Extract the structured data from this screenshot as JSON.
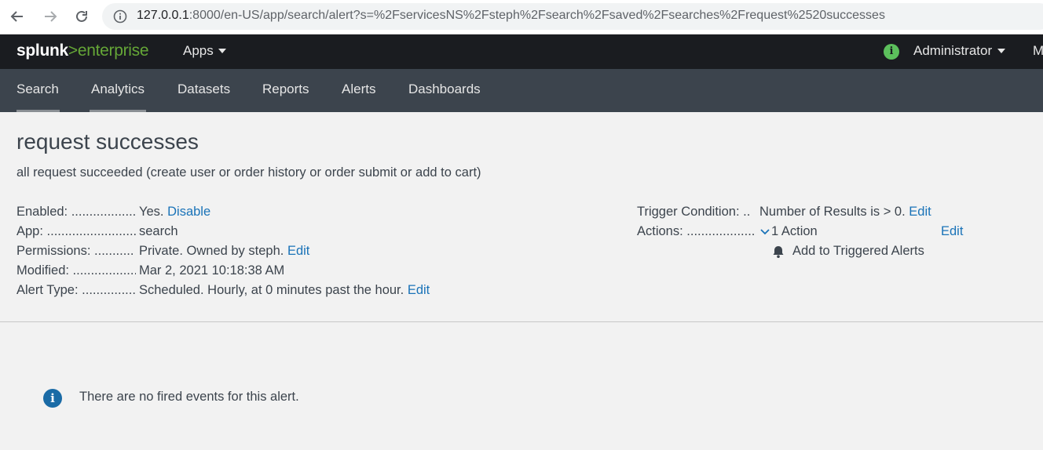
{
  "browser": {
    "url_host": "127.0.0.1",
    "url_rest": ":8000/en-US/app/search/alert?s=%2FservicesNS%2Fsteph%2Fsearch%2Fsaved%2Fsearches%2Frequest%2520successes"
  },
  "topbar": {
    "logo_splunk": "splunk",
    "logo_gt": ">",
    "logo_enterprise": "enterprise",
    "apps_label": "Apps",
    "status_icon": "i",
    "admin_label": "Administrator",
    "more_label": "M"
  },
  "appbar": {
    "tabs": [
      {
        "label": "Search"
      },
      {
        "label": "Analytics"
      },
      {
        "label": "Datasets"
      },
      {
        "label": "Reports"
      },
      {
        "label": "Alerts"
      },
      {
        "label": "Dashboards"
      }
    ]
  },
  "alert": {
    "title": "request successes",
    "description": "all request succeeded (create user or order history or order submit or add to cart)",
    "details": {
      "enabled": {
        "label": "Enabled: ...................",
        "value": "Yes.",
        "link": "Disable"
      },
      "app": {
        "label": "App: ..........................",
        "value": "search"
      },
      "permissions": {
        "label": "Permissions: ...........",
        "value": "Private. Owned by steph.",
        "link": "Edit"
      },
      "modified": {
        "label": "Modified: ..................",
        "value": "Mar 2, 2021 10:18:38 AM"
      },
      "alert_type": {
        "label": "Alert Type: ................",
        "value": "Scheduled. Hourly, at 0 minutes past the hour.",
        "link": "Edit"
      }
    },
    "trigger": {
      "label": "Trigger Condition: ..",
      "value": "Number of Results is > 0.",
      "link": "Edit"
    },
    "actions": {
      "label": "Actions: ....................",
      "value": "1 Action",
      "link": "Edit",
      "item": "Add to Triggered Alerts"
    }
  },
  "events": {
    "info_icon": "i",
    "empty_message": "There are no fired events for this alert."
  },
  "colors": {
    "accent_link": "#1a73b8",
    "brand_green": "#65a637",
    "topbar": "#1a1c20",
    "appbar": "#3c444d"
  }
}
